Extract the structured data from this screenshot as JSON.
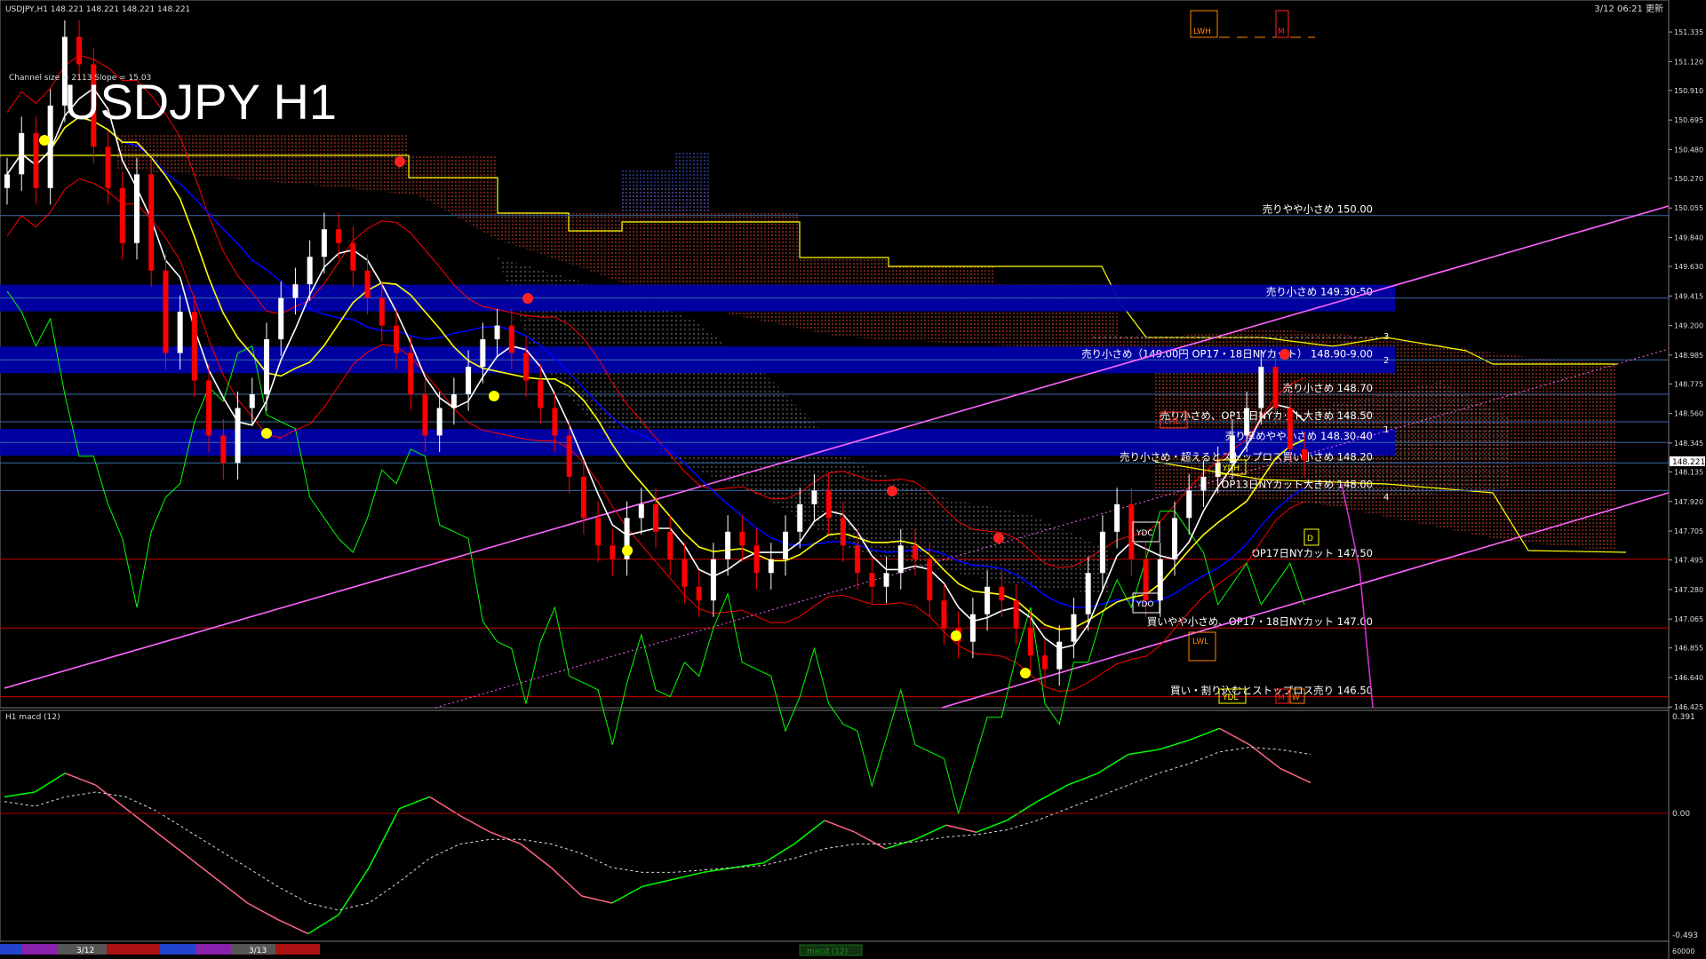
{
  "header": {
    "symbol_info": "USDJPY,H1  148.221 148.221 148.221 148.221",
    "channel_info": "Channel size = 2113 Slope = 15.03",
    "big_title": "USDJPY H1",
    "timestamp": "3/12 06:21 更新"
  },
  "top_markers": [
    "LWH",
    "M"
  ],
  "price_axis": {
    "ticks": [
      "151.335",
      "151.120",
      "150.910",
      "150.695",
      "150.480",
      "150.270",
      "150.055",
      "149.840",
      "149.630",
      "149.415",
      "149.200",
      "148.985",
      "148.775",
      "148.560",
      "148.345",
      "148.135",
      "147.920",
      "147.705",
      "147.495",
      "147.280",
      "147.065",
      "146.855",
      "146.640",
      "146.425"
    ],
    "current_price": "148.221"
  },
  "macd_axis": {
    "ticks": [
      "0.391",
      "0.00",
      "-0.493"
    ],
    "label": "H1 macd (12)"
  },
  "bottom": {
    "dates": [
      "3/12",
      "3/13"
    ],
    "center_label": "macd (12)",
    "right_value": "60000"
  },
  "levels": [
    {
      "label": "売りやや小さめ 150.00",
      "price": 150.0
    },
    {
      "label": "売り小さめ 149.30-50",
      "price": 149.4
    },
    {
      "label": "売り小さめ（149.00円 OP17・18日NYカット） 148.90-9.00",
      "price": 148.95
    },
    {
      "label": "売り小さめ 148.70",
      "price": 148.7
    },
    {
      "label": "売り小さめ、OP13日NYカット大きめ 148.50",
      "price": 148.5
    },
    {
      "label": "売り厚めやや小さめ 148.30-40",
      "price": 148.35
    },
    {
      "label": "売り小さめ・超えるとストップロス買い小さめ 148.20",
      "price": 148.2
    },
    {
      "label": "OP13日NYカット大きめ 148.00",
      "price": 148.0
    },
    {
      "label": "OP17日NYカット 147.50",
      "price": 147.5
    },
    {
      "label": "買いやや小さめ、OP17・18日NYカット 147.00",
      "price": 147.0
    },
    {
      "label": "買い・割り込むとストップロス売り 146.50",
      "price": 146.5
    }
  ],
  "pivot_markers": [
    "LML",
    "YDH",
    "YDC",
    "YDO",
    "LWL",
    "YDL",
    "M",
    "W",
    "D"
  ],
  "channel_numbers": [
    "3",
    "2",
    "1",
    "4"
  ],
  "colors": {
    "background": "#000000",
    "up_candle": "#ffffff",
    "down_candle": "#ff0000",
    "ema_fast": "#ffffff",
    "ema_slow": "#ffff00",
    "ma_blue": "#0000ff",
    "bollinger": "#ff0000",
    "chikou": "#00ff00",
    "kumo_upper": "#ffff00",
    "channel": "#ff66ff",
    "zone": "#0000aa",
    "macd_up": "#00ff00",
    "macd_down": "#ff6680"
  },
  "chart_data": {
    "type": "line",
    "title": "USDJPY H1",
    "ylim": [
      146.42,
      151.4
    ],
    "candles_close": [
      150.3,
      150.6,
      150.2,
      150.8,
      151.3,
      151.1,
      150.5,
      150.2,
      149.8,
      150.3,
      149.6,
      149.0,
      149.3,
      148.8,
      148.4,
      148.2,
      148.6,
      148.7,
      149.1,
      149.4,
      149.5,
      149.7,
      149.9,
      149.8,
      149.6,
      149.4,
      149.2,
      149.0,
      148.7,
      148.4,
      148.6,
      148.7,
      148.9,
      149.1,
      149.2,
      149.0,
      148.8,
      148.6,
      148.4,
      148.1,
      147.8,
      147.6,
      147.5,
      147.8,
      147.9,
      147.7,
      147.5,
      147.3,
      147.2,
      147.5,
      147.7,
      147.6,
      147.4,
      147.5,
      147.7,
      147.9,
      148.0,
      147.8,
      147.6,
      147.4,
      147.3,
      147.4,
      147.6,
      147.5,
      147.2,
      147.0,
      146.9,
      147.1,
      147.3,
      147.2,
      147.0,
      146.8,
      146.7,
      146.9,
      147.1,
      147.4,
      147.7,
      147.9,
      147.5,
      147.2,
      147.5,
      147.8,
      148.0,
      148.1,
      148.2,
      148.4,
      148.6,
      148.9,
      148.6,
      148.3,
      148.22
    ],
    "macd": [
      0.1,
      0.12,
      0.2,
      0.15,
      0.05,
      -0.05,
      -0.15,
      -0.25,
      -0.35,
      -0.42,
      -0.48,
      -0.4,
      -0.2,
      0.05,
      0.1,
      0.02,
      -0.05,
      -0.1,
      -0.2,
      -0.32,
      -0.35,
      -0.28,
      -0.25,
      -0.22,
      -0.2,
      -0.18,
      -0.1,
      0.0,
      -0.05,
      -0.12,
      -0.08,
      -0.02,
      -0.05,
      0.0,
      0.08,
      0.15,
      0.2,
      0.28,
      0.3,
      0.34,
      0.39,
      0.32,
      0.22,
      0.16
    ],
    "signal": [
      0.08,
      0.06,
      0.1,
      0.12,
      0.1,
      0.04,
      -0.04,
      -0.12,
      -0.2,
      -0.28,
      -0.35,
      -0.38,
      -0.35,
      -0.26,
      -0.16,
      -0.1,
      -0.08,
      -0.08,
      -0.1,
      -0.14,
      -0.2,
      -0.22,
      -0.22,
      -0.21,
      -0.2,
      -0.19,
      -0.16,
      -0.12,
      -0.1,
      -0.1,
      -0.09,
      -0.07,
      -0.06,
      -0.04,
      0.0,
      0.05,
      0.1,
      0.15,
      0.2,
      0.24,
      0.29,
      0.31,
      0.3,
      0.28
    ],
    "xlabel": "",
    "ylabel": ""
  }
}
